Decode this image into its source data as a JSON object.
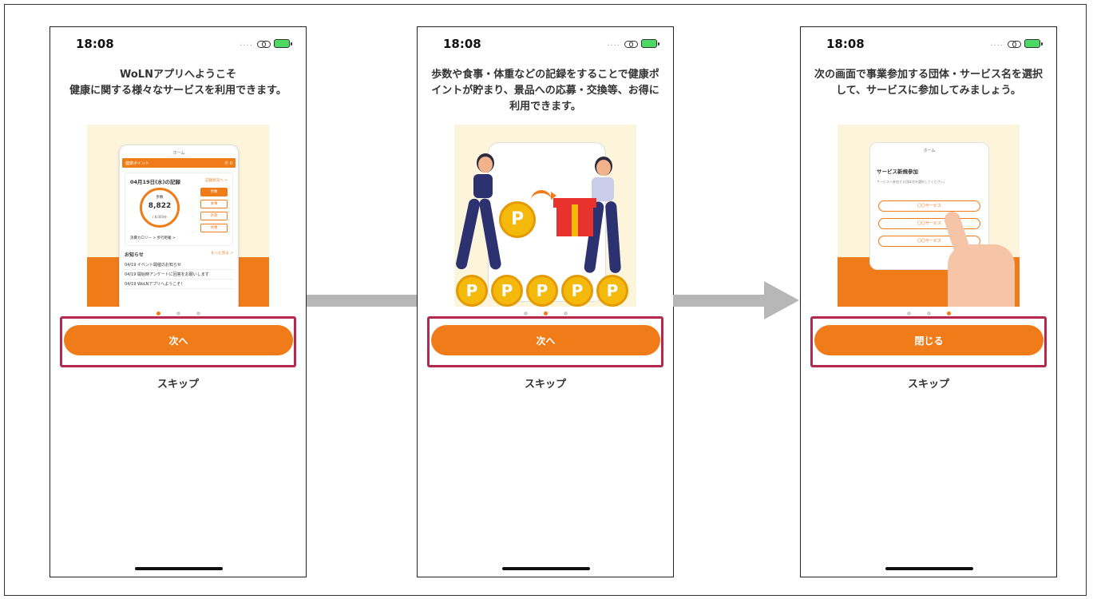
{
  "screens": [
    {
      "status_time": "18:08",
      "intro_line1": "WoLNアプリへようこそ",
      "intro_line2": "健康に関する様々なサービスを利用できます。",
      "illustration": {
        "header": "ホーム",
        "points_bar": "健康ポイント",
        "points_value": "Ⓟ 0",
        "card_title": "04月19日(水)の記録",
        "card_link": "記録状況へ >",
        "steps_label": "歩数",
        "steps_value": "8,822",
        "steps_goal": "/ 8,000歩",
        "calorie_text": "消費カロリー > 歩行距離 >",
        "buttons": [
          "歩数",
          "食事",
          "計測",
          "体重"
        ],
        "news_title": "お知らせ",
        "news_more": "もっと見る >",
        "news": [
          "04/19 イベント開催のお知らせ",
          "04/19 開始時アンケートに回答をお願いします",
          "04/19 WoLNアプリへようこそ！"
        ]
      },
      "button_label": "次へ",
      "skip_label": "スキップ",
      "active_page": 0
    },
    {
      "status_time": "18:08",
      "intro_line1": "歩数や食事・体重などの記録をすることで健康ポ",
      "intro_line2": "イントが貯まり、景品への応募・交換等、お得に",
      "intro_line3": "利用できます。",
      "coin_letter": "P",
      "button_label": "次へ",
      "skip_label": "スキップ",
      "active_page": 1
    },
    {
      "status_time": "18:08",
      "intro_line1": "次の画面で事業参加する団体・サービス名を選択",
      "intro_line2": "して、サービスに参加してみましょう。",
      "illustration": {
        "header": "ホーム",
        "title": "サービス新規参加",
        "subtitle": "サービスへ参加する団体名を選択してください。",
        "options": [
          "〇〇サービス",
          "〇〇サービス",
          "〇〇サービス"
        ]
      },
      "button_label": "閉じる",
      "skip_label": "スキップ",
      "active_page": 2
    }
  ],
  "colors": {
    "accent": "#f07c19",
    "highlight": "#b32a4e",
    "arrow": "#b7b7b7"
  }
}
